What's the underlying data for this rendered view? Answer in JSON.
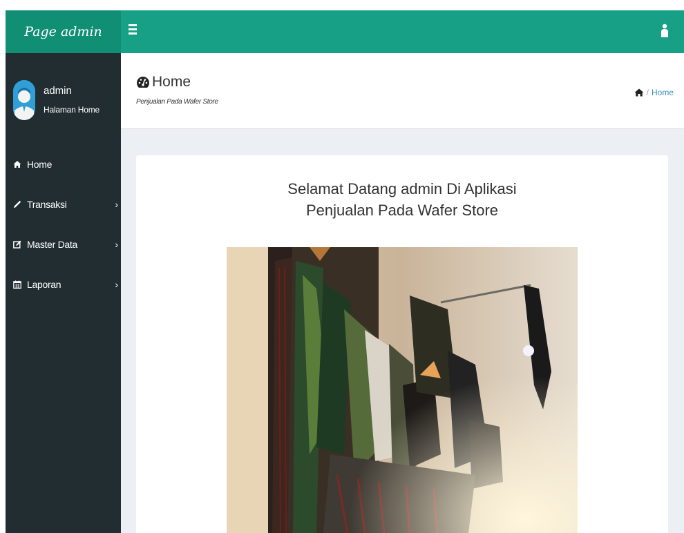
{
  "brand": {
    "name": "Page admin"
  },
  "user": {
    "name": "admin",
    "subtitle": "Halaman Home"
  },
  "sidebar": {
    "items": [
      {
        "label": "Home",
        "icon": "home-icon",
        "has_children": false
      },
      {
        "label": "Transaksi",
        "icon": "pencil-icon",
        "has_children": true
      },
      {
        "label": "Master Data",
        "icon": "edit-icon",
        "has_children": true
      },
      {
        "label": "Laporan",
        "icon": "calendar-icon",
        "has_children": true
      }
    ],
    "chevron": "›"
  },
  "header": {
    "title": "Home",
    "subtitle": "Penjualan Pada Wafer Store",
    "breadcrumb_separator": "/",
    "breadcrumb_current": "Home"
  },
  "main": {
    "welcome_line1": "Selamat Datang admin Di Aplikasi",
    "welcome_line2": "Penjualan Pada Wafer Store"
  },
  "colors": {
    "topbar": "#17a085",
    "brand_bg": "#118f75",
    "sidebar": "#222d32",
    "content_bg": "#ecf0f5",
    "link": "#3c8dbc"
  }
}
